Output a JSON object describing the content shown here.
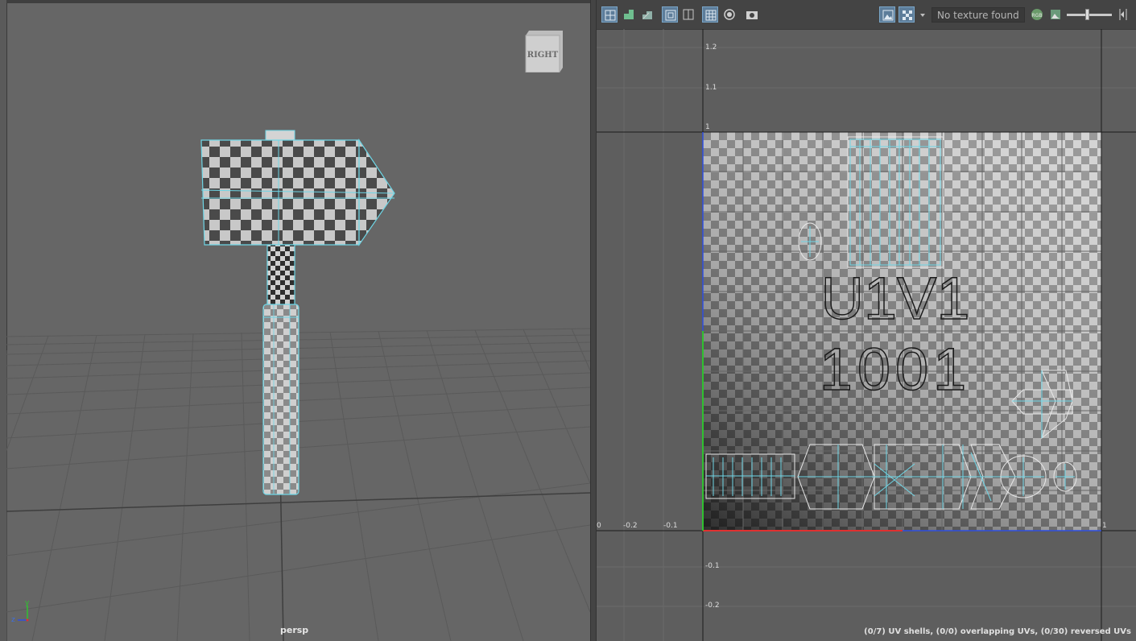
{
  "viewport": {
    "camera_label": "persp",
    "viewcube_label": "RIGHT",
    "axis_labels": {
      "y": "y",
      "z": "z"
    }
  },
  "uv_editor": {
    "texture_field": "No texture found",
    "rgb_icon_label": "RGB",
    "tile_label_top": "U1V1",
    "tile_label_bottom": "1001",
    "axis_ticks": {
      "v": [
        "1.2",
        "1.1",
        "1",
        "-0.1",
        "-0.2"
      ],
      "u": [
        "0",
        "-0.2",
        "-0.1",
        "1"
      ]
    },
    "status": "(0/7) UV shells, (0/0) overlapping UVs, (0/30) reversed UVs"
  },
  "colors": {
    "viewport_bg": "#666666",
    "uv_bg": "#5e5e5e",
    "wire_select": "#6fd6e6",
    "axis_u": "#e03030",
    "axis_v_green": "#30c030",
    "axis_v_blue": "#2f4fe0"
  }
}
